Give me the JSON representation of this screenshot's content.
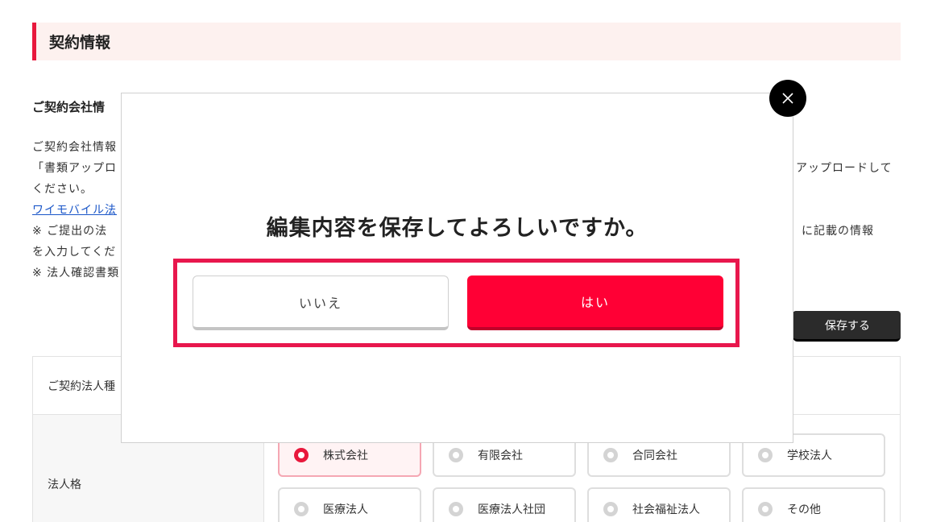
{
  "section": {
    "title": "契約情報"
  },
  "company_info": {
    "subtitle": "ご契約会社情",
    "desc_line1": "ご契約会社情報",
    "desc_line2_left": "「書類アップロ",
    "desc_line2_right": "アップロードして",
    "desc_line3": "ください。",
    "link_text": "ワイモバイル法",
    "desc_line4_left": "※ ご提出の法",
    "desc_line4_right": "」）に記載の情報",
    "desc_line5": "を入力してくだ",
    "desc_line6": "※ 法人確認書類"
  },
  "save_button_label": "保存する",
  "form": {
    "row1_label": "ご契約法人種",
    "row2_label": "法人格",
    "corp_types": [
      {
        "label": "株式会社",
        "selected": true
      },
      {
        "label": "有限会社",
        "selected": false
      },
      {
        "label": "合同会社",
        "selected": false
      },
      {
        "label": "学校法人",
        "selected": false
      },
      {
        "label": "医療法人",
        "selected": false
      },
      {
        "label": "医療法人社団",
        "selected": false
      },
      {
        "label": "社会福祉法人",
        "selected": false
      },
      {
        "label": "その他",
        "selected": false
      }
    ]
  },
  "modal": {
    "message": "編集内容を保存してよろしいですか。",
    "no_label": "いいえ",
    "yes_label": "はい",
    "close_icon": "close-icon"
  },
  "colors": {
    "accent": "#e8183c",
    "yes_button": "#ff0035",
    "highlight_frame": "#e8174d",
    "header_bg": "#fdf1ef"
  }
}
